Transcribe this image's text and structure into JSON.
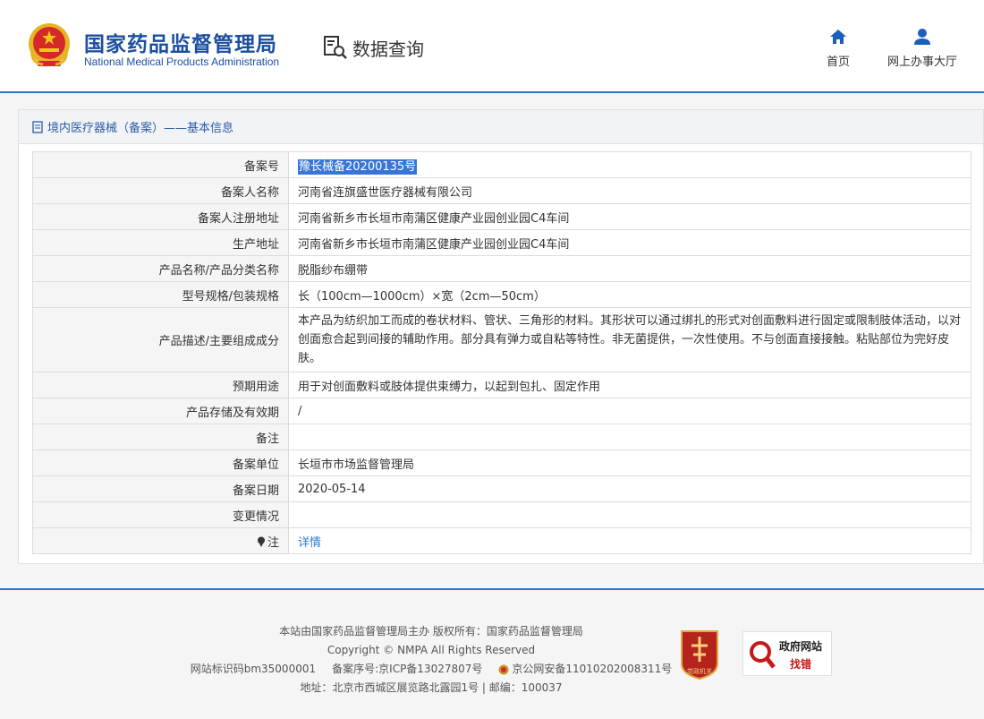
{
  "header": {
    "brand_cn": "国家药品监督管理局",
    "brand_en": "National Medical Products Administration",
    "query_title": "数据查询",
    "nav": [
      {
        "label": "首页",
        "icon": "home-icon"
      },
      {
        "label": "网上办事大厅",
        "icon": "user-icon"
      }
    ]
  },
  "panel": {
    "title": "境内医疗器械（备案）——基本信息"
  },
  "rows": [
    {
      "label": "备案号",
      "value": "豫长械备20200135号"
    },
    {
      "label": "备案人名称",
      "value": "河南省连旗盛世医疗器械有限公司"
    },
    {
      "label": "备案人注册地址",
      "value": "河南省新乡市长垣市南蒲区健康产业园创业园C4车间"
    },
    {
      "label": "生产地址",
      "value": "河南省新乡市长垣市南蒲区健康产业园创业园C4车间"
    },
    {
      "label": "产品名称/产品分类名称",
      "value": "脱脂纱布绷带"
    },
    {
      "label": "型号规格/包装规格",
      "value": "长（100cm—1000cm）×宽（2cm—50cm）"
    },
    {
      "label": "产品描述/主要组成成分",
      "value": "本产品为纺织加工而成的卷状材料、管状、三角形的材料。其形状可以通过绑扎的形式对创面敷料进行固定或限制肢体活动，以对创面愈合起到间接的辅助作用。部分具有弹力或自粘等特性。非无菌提供，一次性使用。不与创面直接接触。粘贴部位为完好皮肤。"
    },
    {
      "label": "预期用途",
      "value": "用于对创面敷料或肢体提供束缚力，以起到包扎、固定作用"
    },
    {
      "label": "产品存储及有效期",
      "value": "/"
    },
    {
      "label": "备注",
      "value": ""
    },
    {
      "label": "备案单位",
      "value": "长垣市市场监督管理局"
    },
    {
      "label": "备案日期",
      "value": "2020-05-14"
    },
    {
      "label": "变更情况",
      "value": ""
    },
    {
      "label": "注",
      "value": "详情"
    }
  ],
  "footer": {
    "line1": "本站由国家药品监督管理局主办 版权所有：国家药品监督管理局",
    "line2": "Copyright © NMPA All Rights Reserved",
    "site_id": "网站标识码bm35000001",
    "icp": "备案序号:京ICP备13027807号",
    "police": "京公网安备11010202008311号",
    "address": "地址：北京市西城区展览路北露园1号 | 邮编：100037",
    "party_badge": "党政机关",
    "gov_badge_line1": "政府网站",
    "gov_badge_line2": "找错"
  },
  "colors": {
    "brand_blue": "#1c4fa0",
    "accent_blue": "#2c74c9",
    "highlight": "#3875d7",
    "link": "#2b7cd3"
  }
}
